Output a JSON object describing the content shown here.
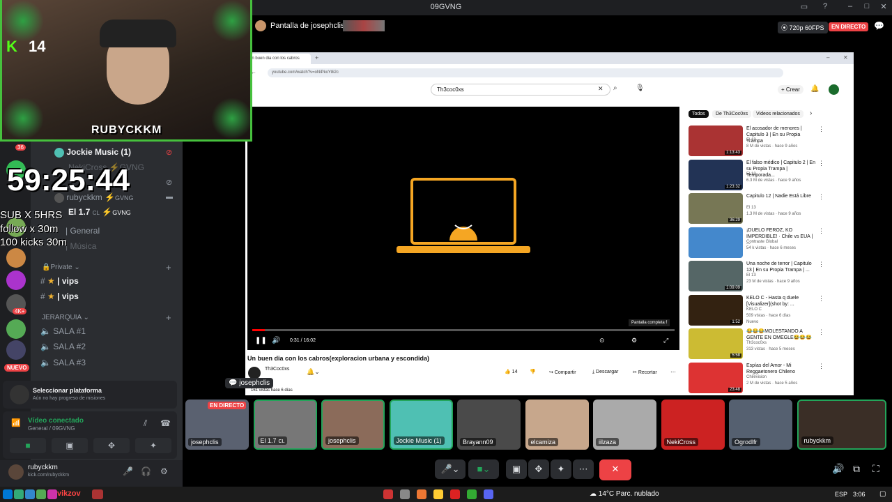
{
  "window": {
    "title": "09GVNG"
  },
  "stream_header": {
    "title": "Pantalla de josephclis",
    "quality": "720p 60FPS",
    "live": "EN DIRECTO"
  },
  "overlay": {
    "kick_count": "14",
    "streamer_tag": "RUBYCKKM",
    "timer": "59:25:44",
    "sub_lines": [
      "SUB X 5HRS",
      "follow x 30m",
      "100 kicks 30m"
    ]
  },
  "channels": {
    "voice_users": [
      {
        "name": "Jockie Music (1)"
      },
      {
        "name": "NekiCross",
        "tag": "GVNG"
      },
      {
        "name": "rubyckkm",
        "tag": "GVNG"
      },
      {
        "name": "El 1.7",
        "suffix": "CL",
        "tag": "GVNG"
      }
    ],
    "text": [
      {
        "name": "| General"
      },
      {
        "name": "| Música"
      }
    ],
    "private_category": "Private",
    "private_channels": [
      {
        "name": "| vips"
      },
      {
        "name": "| vips"
      }
    ],
    "jerarquia_category": "JERARQUIA",
    "salas": [
      {
        "name": "SALA #1"
      },
      {
        "name": "SALA #2"
      },
      {
        "name": "SALA #3"
      }
    ]
  },
  "server_badges": {
    "b1": "36",
    "nuevo": "NUEVO",
    "b2": "4K+"
  },
  "quest": {
    "title": "Seleccionar plataforma",
    "subtitle": "Aún no hay progreso de misiones"
  },
  "voice_status": {
    "title": "Vídeo conectado",
    "channel": "General / 09GVNG"
  },
  "user": {
    "name": "rubyckkm",
    "status": "kick.com/rubyckkm"
  },
  "browser": {
    "tab": "Un buen dia con los cabros",
    "url": "youtube.com/watch?v=oNiPkoY8i2c",
    "search": "Th3coc0xs",
    "create": "Crear"
  },
  "youtube": {
    "video_title": "Un buen dia con los cabros(exploracion urbana y escondida)",
    "channel": "Th3Coc0xs",
    "time": "0:31 / 16:02",
    "fullscreen_tip": "Pantalla completa",
    "fullscreen_key": "f",
    "likes": "14",
    "share": "Compartir",
    "download": "Descargar",
    "clip": "Recortar",
    "views": "161 vistas  hace 6 días",
    "chips": [
      "Todos",
      "De Th3Coc0xs",
      "Videos relacionados"
    ],
    "side": [
      {
        "title": "El acosador de menores | Capitulo 3 | En su Propia Trampa",
        "ch": "El 13",
        "meta": "8 M de vistas · hace 9 años",
        "dur": "1:13:43",
        "color": "#a33"
      },
      {
        "title": "El falso médico | Capitulo 2 | En su Propia Trampa | Temporada...",
        "ch": "El 13",
        "meta": "6.3 M de vistas · hace 9 años",
        "dur": "1:23:32",
        "color": "#235"
      },
      {
        "title": "Capitulo 12 | Nadie Está Libre",
        "ch": "El 13",
        "meta": "1.3 M de vistas · hace 9 años",
        "dur": "36:29",
        "color": "#775"
      },
      {
        "title": "¡DUELO FEROZ, KO IMPERDIBLE! · Chile vs EUA | ...",
        "ch": "Contraste Global",
        "meta": "54 k vistas · hace 6 meses",
        "dur": "",
        "color": "#48c"
      },
      {
        "title": "Una noche de terror | Capitulo 13 | En su Propia Trampa | ...",
        "ch": "El 13",
        "meta": "23 M de vistas · hace 9 años",
        "dur": "1:09:09",
        "color": "#566"
      },
      {
        "title": "KELO C - Hasta q duele [Visualizer](shot by: ...",
        "ch": "KELO C",
        "meta": "509 vistas · hace 6 días",
        "dur": "1:52",
        "color": "#321",
        "badge": "Nuevo"
      },
      {
        "title": "😂😂😂MOLESTANDO A GENTE EN OMEGLE😂😂😂",
        "ch": "Th3coc0xs",
        "meta": "313 vistas · hace 5 meses",
        "dur": "5:58",
        "color": "#cb3"
      },
      {
        "title": "Espías del Amor - Mi Reggaetonero Chileno",
        "ch": "Chilevision",
        "meta": "2 M de vistas · hace 5 años",
        "dur": "23:48",
        "color": "#d33"
      }
    ]
  },
  "hover_label": "josephclis",
  "tiles": [
    {
      "name": "josephclis",
      "live": "EN DIRECTO",
      "color": "#5a6170"
    },
    {
      "name": "El 1.7",
      "suffix": "CL",
      "color": "#777"
    },
    {
      "name": "josephclis",
      "color": "#8b6b5a"
    },
    {
      "name": "Jockie Music (1)",
      "color": "#4fc0b3"
    },
    {
      "name": "Brayann09",
      "color": "#4a4a4a"
    },
    {
      "name": "elcamiza",
      "color": "#c7a78c"
    },
    {
      "name": "iilzaza",
      "color": "#aaa"
    },
    {
      "name": "NekiCross",
      "color": "#c22"
    },
    {
      "name": "Ogrodlfr",
      "color": "#556070"
    },
    {
      "name": "rubyckkm",
      "color": "#3a2e26"
    }
  ],
  "taskbar": {
    "weather": "14°C  Parc. nublado",
    "lang": "ESP",
    "time": "3:06",
    "chat_user": "vikzov"
  },
  "colors": {
    "accent": "#5865f2",
    "live_red": "#ed4245",
    "green": "#23a55a",
    "kick": "#53fc18"
  }
}
